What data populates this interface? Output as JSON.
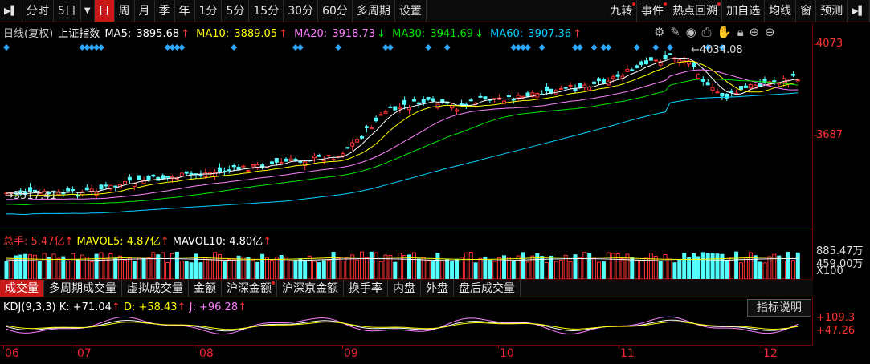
{
  "toolbar": {
    "left": [
      "分时",
      "5日",
      "日",
      "周",
      "月",
      "季",
      "年",
      "1分",
      "5分",
      "15分",
      "30分",
      "60分",
      "多周期",
      "设置"
    ],
    "active": "日",
    "right": [
      "九转",
      "事件",
      "热点回溯",
      "加自选",
      "均线",
      "窗",
      "预测"
    ],
    "right_dot": [
      "九转",
      "事件",
      "热点回溯"
    ]
  },
  "main_legend": {
    "title": "日线(复权)",
    "index_name": "上证指数",
    "ma5_label": "MA5:",
    "ma5": "3895.68",
    "ma5_arrow": "↑",
    "ma10_label": "MA10:",
    "ma10": "3889.05",
    "ma10_arrow": "↑",
    "ma20_label": "MA20:",
    "ma20": "3918.73",
    "ma20_arrow": "↓",
    "ma30_label": "MA30:",
    "ma30": "3941.69",
    "ma30_arrow": "↓",
    "ma60_label": "MA60:",
    "ma60": "3907.36",
    "ma60_arrow": "↑"
  },
  "price_axis": {
    "high": "4073",
    "mid": "3687"
  },
  "annotations": {
    "high_mark": "4034.08",
    "low_mark": "3517.41"
  },
  "volume_legend": {
    "total_label": "总手:",
    "total": "5.47亿",
    "total_arrow": "↑",
    "mavol5_label": "MAVOL5:",
    "mavol5": "4.87亿",
    "mavol5_arrow": "↑",
    "mavol10_label": "MAVOL10:",
    "mavol10": "4.80亿",
    "mavol10_arrow": "↑"
  },
  "volume_axis": {
    "top": "885.47万",
    "mid": "459.00万",
    "unit": "X100"
  },
  "subtabs": {
    "items": [
      "成交量",
      "多周期成交量",
      "虚拟成交量",
      "金额",
      "沪深金额",
      "沪深京金额",
      "换手率",
      "内盘",
      "外盘",
      "盘后成交量"
    ],
    "active": "成交量",
    "dot": [
      "沪深金额"
    ]
  },
  "kdj_legend": {
    "name": "KDJ(9,3,3)",
    "k_label": "K:",
    "k": "+71.04",
    "k_arrow": "↑",
    "d_label": "D:",
    "d": "+58.43",
    "d_arrow": "↑",
    "j_label": "J:",
    "j": "+96.28",
    "j_arrow": "↑"
  },
  "kdj_axis": {
    "top": "+109.3",
    "mid": "+47.26"
  },
  "help_button": "指标说明",
  "x_axis": [
    "06",
    "07",
    "08",
    "09",
    "10",
    "11",
    "12"
  ],
  "colors": {
    "up": "#ff3232",
    "down": "#54ffff",
    "ma5": "#ffffff",
    "ma10": "#ffff00",
    "ma20": "#ff80ff",
    "ma30": "#00e600",
    "ma60": "#00d2ff"
  },
  "tool_icons": [
    "settings-icon",
    "pen-icon",
    "eye-icon",
    "print-icon",
    "hand-icon",
    "lock-icon",
    "zoom-in-icon",
    "zoom-out-icon"
  ]
}
